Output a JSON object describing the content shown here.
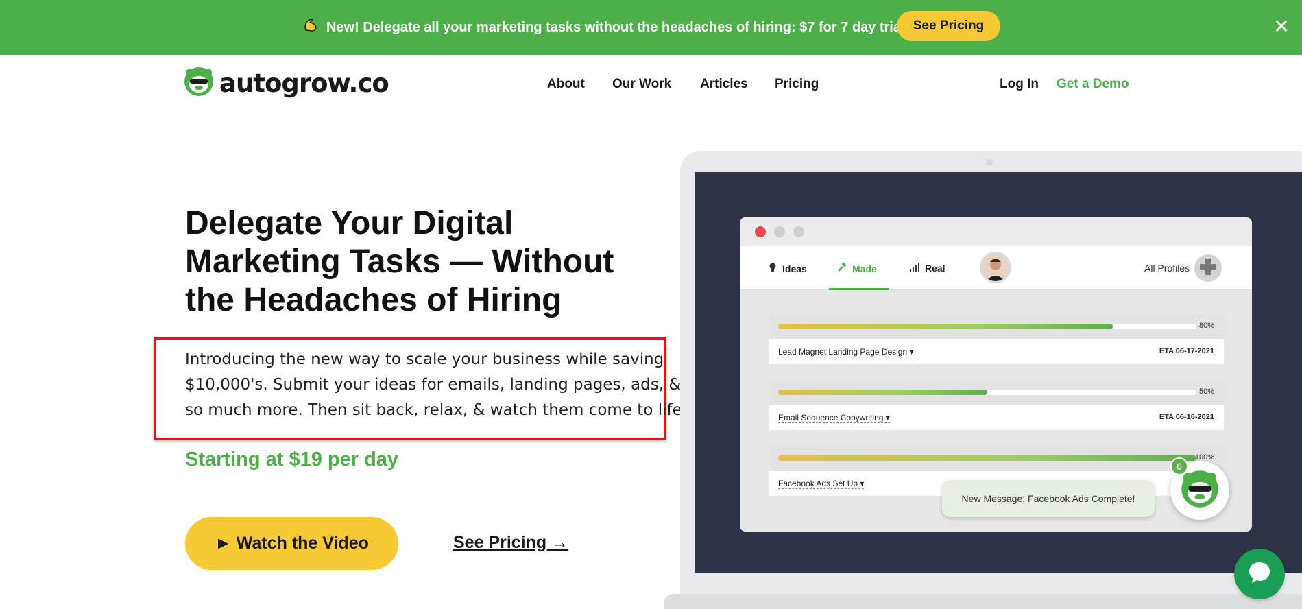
{
  "promo": {
    "text": "New! Delegate all your marketing tasks without the headaches of hiring: $7 for 7 day trial",
    "button": "See Pricing",
    "close": "✕"
  },
  "nav": {
    "logo": "autogrow.co",
    "links": [
      "About",
      "Our Work",
      "Articles",
      "Pricing"
    ],
    "login": "Log In",
    "demo": "Get a Demo"
  },
  "hero": {
    "title_lines": [
      "Delegate Your Digital",
      "Marketing Tasks — Without",
      "the Headaches of Hiring"
    ],
    "desc_lines": [
      "Introducing the new way to scale your business while saving",
      "$10,000's. Submit your ideas for emails, landing pages, ads, &",
      "so much more. Then sit back, relax, & watch them come to life."
    ],
    "price": "Starting at $19 per day",
    "video_button": "► Watch the Video",
    "pricing_link": "See Pricing →"
  },
  "app": {
    "tabs": [
      "Ideas",
      "Made",
      "Real"
    ],
    "all_profiles": "All Profiles",
    "tasks": [
      {
        "name": "Lead Magnet Landing Page Design ▾",
        "progress": 0.8,
        "pct": "80%",
        "eta": "ETA 06-17-2021"
      },
      {
        "name": "Email Sequence Copywriting ▾",
        "progress": 0.5,
        "pct": "50%",
        "eta": "ETA 06-16-2021"
      },
      {
        "name": "Facebook Ads Set Up ▾",
        "progress": 1.0,
        "pct": "100%",
        "eta": ""
      }
    ],
    "notification": "New Message: Facebook Ads Complete!",
    "badge_count": "6"
  },
  "colors": {
    "brand_green": "#4caf48",
    "accent_yellow": "#f7c934",
    "highlight_red": "#d11b1b",
    "screen_dark": "#2e3347"
  }
}
